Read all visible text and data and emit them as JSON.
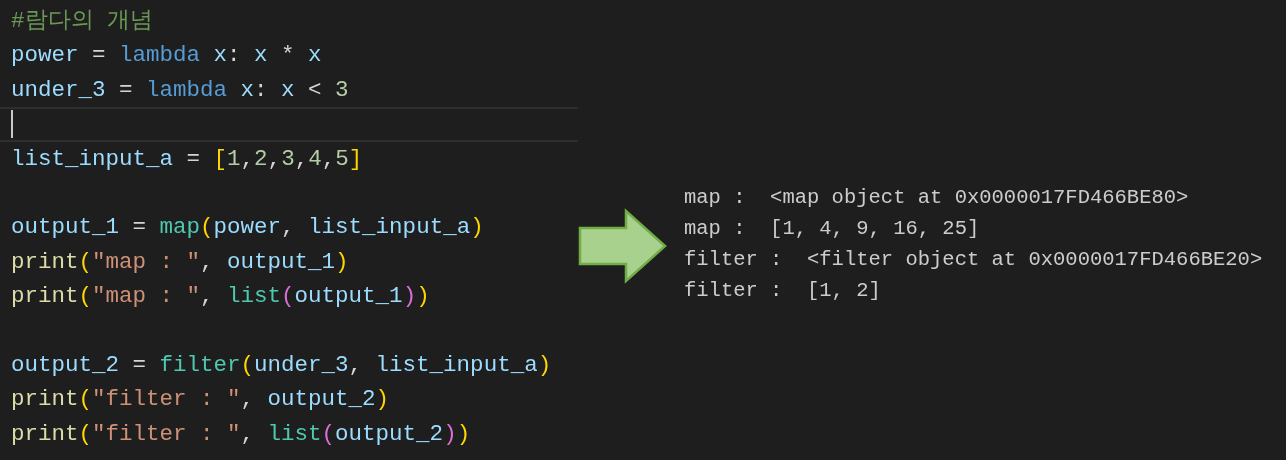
{
  "editor": {
    "lines": [
      {
        "kind": "code",
        "tokens": [
          {
            "text": "#람다의 개념",
            "kind": "comment"
          }
        ]
      },
      {
        "kind": "code",
        "tokens": [
          {
            "text": "power",
            "kind": "variable"
          },
          {
            "text": " = ",
            "kind": "operator"
          },
          {
            "text": "lambda",
            "kind": "keyword"
          },
          {
            "text": " x",
            "kind": "variable"
          },
          {
            "text": ": ",
            "kind": "operator"
          },
          {
            "text": "x",
            "kind": "variable"
          },
          {
            "text": " * ",
            "kind": "operator"
          },
          {
            "text": "x",
            "kind": "variable"
          }
        ]
      },
      {
        "kind": "code",
        "tokens": [
          {
            "text": "under_3",
            "kind": "variable"
          },
          {
            "text": " = ",
            "kind": "operator"
          },
          {
            "text": "lambda",
            "kind": "keyword"
          },
          {
            "text": " x",
            "kind": "variable"
          },
          {
            "text": ": ",
            "kind": "operator"
          },
          {
            "text": "x",
            "kind": "variable"
          },
          {
            "text": " < ",
            "kind": "operator"
          },
          {
            "text": "3",
            "kind": "number"
          }
        ]
      },
      {
        "kind": "cursor"
      },
      {
        "kind": "code",
        "tokens": [
          {
            "text": "list_input_a",
            "kind": "variable"
          },
          {
            "text": " = ",
            "kind": "operator"
          },
          {
            "text": "[",
            "kind": "bracket1"
          },
          {
            "text": "1",
            "kind": "number"
          },
          {
            "text": ",",
            "kind": "operator"
          },
          {
            "text": "2",
            "kind": "number"
          },
          {
            "text": ",",
            "kind": "operator"
          },
          {
            "text": "3",
            "kind": "number"
          },
          {
            "text": ",",
            "kind": "operator"
          },
          {
            "text": "4",
            "kind": "number"
          },
          {
            "text": ",",
            "kind": "operator"
          },
          {
            "text": "5",
            "kind": "number"
          },
          {
            "text": "]",
            "kind": "bracket1"
          }
        ]
      },
      {
        "kind": "blank"
      },
      {
        "kind": "code",
        "tokens": [
          {
            "text": "output_1",
            "kind": "variable"
          },
          {
            "text": " = ",
            "kind": "operator"
          },
          {
            "text": "map",
            "kind": "builtin"
          },
          {
            "text": "(",
            "kind": "bracket1"
          },
          {
            "text": "power",
            "kind": "variable"
          },
          {
            "text": ", ",
            "kind": "operator"
          },
          {
            "text": "list_input_a",
            "kind": "variable"
          },
          {
            "text": ")",
            "kind": "bracket1"
          }
        ]
      },
      {
        "kind": "code",
        "tokens": [
          {
            "text": "print",
            "kind": "function"
          },
          {
            "text": "(",
            "kind": "bracket1"
          },
          {
            "text": "\"map : \"",
            "kind": "string"
          },
          {
            "text": ", ",
            "kind": "operator"
          },
          {
            "text": "output_1",
            "kind": "variable"
          },
          {
            "text": ")",
            "kind": "bracket1"
          }
        ]
      },
      {
        "kind": "code",
        "tokens": [
          {
            "text": "print",
            "kind": "function"
          },
          {
            "text": "(",
            "kind": "bracket1"
          },
          {
            "text": "\"map : \"",
            "kind": "string"
          },
          {
            "text": ", ",
            "kind": "operator"
          },
          {
            "text": "list",
            "kind": "builtin"
          },
          {
            "text": "(",
            "kind": "bracket2"
          },
          {
            "text": "output_1",
            "kind": "variable"
          },
          {
            "text": ")",
            "kind": "bracket2"
          },
          {
            "text": ")",
            "kind": "bracket1"
          }
        ]
      },
      {
        "kind": "blank"
      },
      {
        "kind": "code",
        "tokens": [
          {
            "text": "output_2",
            "kind": "variable"
          },
          {
            "text": " = ",
            "kind": "operator"
          },
          {
            "text": "filter",
            "kind": "builtin"
          },
          {
            "text": "(",
            "kind": "bracket1"
          },
          {
            "text": "under_3",
            "kind": "variable"
          },
          {
            "text": ", ",
            "kind": "operator"
          },
          {
            "text": "list_input_a",
            "kind": "variable"
          },
          {
            "text": ")",
            "kind": "bracket1"
          }
        ]
      },
      {
        "kind": "code",
        "tokens": [
          {
            "text": "print",
            "kind": "function"
          },
          {
            "text": "(",
            "kind": "bracket1"
          },
          {
            "text": "\"filter : \"",
            "kind": "string"
          },
          {
            "text": ", ",
            "kind": "operator"
          },
          {
            "text": "output_2",
            "kind": "variable"
          },
          {
            "text": ")",
            "kind": "bracket1"
          }
        ]
      },
      {
        "kind": "code",
        "tokens": [
          {
            "text": "print",
            "kind": "function"
          },
          {
            "text": "(",
            "kind": "bracket1"
          },
          {
            "text": "\"filter : \"",
            "kind": "string"
          },
          {
            "text": ", ",
            "kind": "operator"
          },
          {
            "text": "list",
            "kind": "builtin"
          },
          {
            "text": "(",
            "kind": "bracket2"
          },
          {
            "text": "output_2",
            "kind": "variable"
          },
          {
            "text": ")",
            "kind": "bracket2"
          },
          {
            "text": ")",
            "kind": "bracket1"
          }
        ]
      }
    ]
  },
  "output": {
    "lines": [
      "map :  <map object at 0x0000017FD466BE80>",
      "map :  [1, 4, 9, 16, 25]",
      "filter :  <filter object at 0x0000017FD466BE20>",
      "filter :  [1, 2]"
    ]
  }
}
